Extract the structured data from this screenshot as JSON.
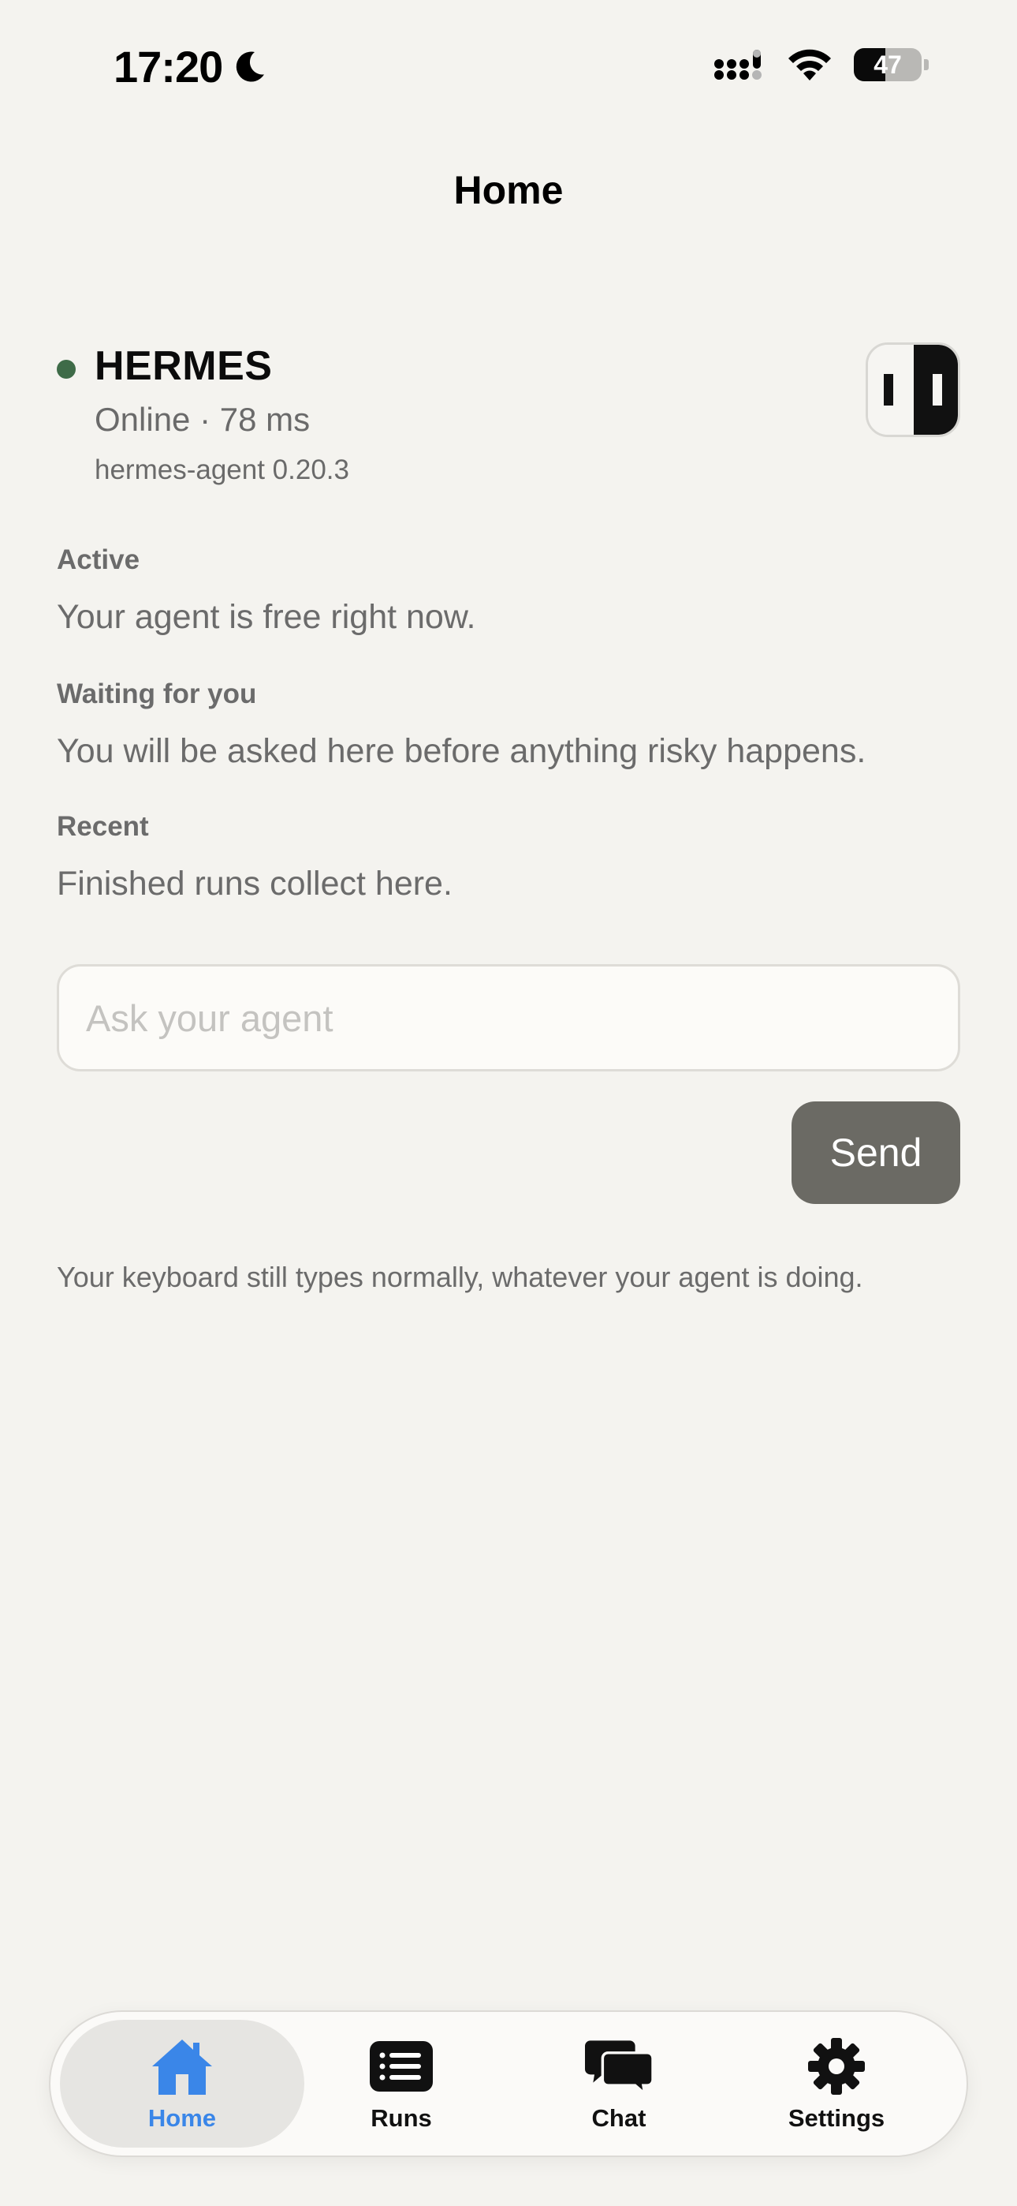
{
  "status_bar": {
    "time": "17:20",
    "battery_level": "47"
  },
  "header": {
    "title": "Home"
  },
  "agent": {
    "name": "HERMES",
    "status": "Online · 78 ms",
    "version": "hermes-agent 0.20.3",
    "status_color": "#3e6b48"
  },
  "sections": {
    "active": {
      "label": "Active",
      "text": "Your agent is free right now."
    },
    "waiting": {
      "label": "Waiting for you",
      "text": "You will be asked here before anything risky happens."
    },
    "recent": {
      "label": "Recent",
      "text": "Finished runs collect here."
    }
  },
  "composer": {
    "placeholder": "Ask your agent",
    "value": "",
    "send_label": "Send",
    "hint": "Your keyboard still types normally, whatever your agent is doing."
  },
  "tabbar": {
    "tabs": [
      {
        "label": "Home",
        "icon": "home-icon",
        "active": true
      },
      {
        "label": "Runs",
        "icon": "list-icon",
        "active": false
      },
      {
        "label": "Chat",
        "icon": "chat-bubbles-icon",
        "active": false
      },
      {
        "label": "Settings",
        "icon": "gear-icon",
        "active": false
      }
    ],
    "active_color": "#3a86e8"
  }
}
